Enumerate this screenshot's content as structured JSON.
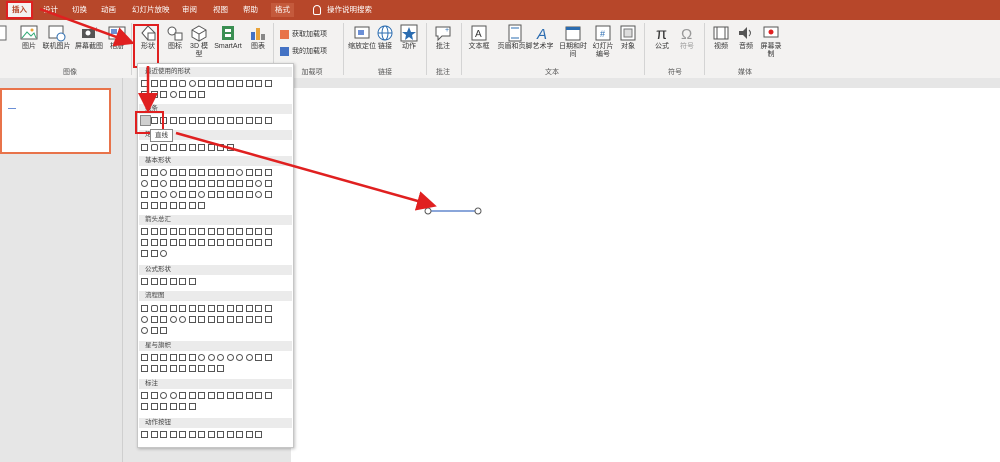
{
  "tabs": [
    "插入",
    "设计",
    "切换",
    "动画",
    "幻灯片放映",
    "审阅",
    "视图",
    "帮助",
    "格式"
  ],
  "tell_me": "操作说明搜索",
  "ribbon": {
    "images": {
      "picture": "图片",
      "online_picture": "联机图片",
      "screenshot": "屏幕截图",
      "album": "相册",
      "group": "图像"
    },
    "illustrations": {
      "shapes": "形状",
      "icons": "图标",
      "model3d": "3D 模型",
      "smartart": "SmartArt",
      "chart": "图表"
    },
    "addins": {
      "get": "获取加载项",
      "my": "我的加载项",
      "group": "加载项"
    },
    "links": {
      "zoom": "缩放定位",
      "link": "链接",
      "action": "动作",
      "group": "链接"
    },
    "comments": {
      "comment": "批注",
      "group": "批注"
    },
    "text": {
      "textbox": "文本框",
      "header_footer": "页眉和页脚",
      "wordart": "艺术字",
      "datetime": "日期和时间",
      "slide_number": "幻灯片编号",
      "object": "对象",
      "group": "文本"
    },
    "symbols": {
      "equation": "公式",
      "symbol": "符号",
      "group": "符号"
    },
    "media": {
      "video": "视频",
      "audio": "音频",
      "screen_recording": "屏幕录制",
      "group": "媒体"
    }
  },
  "gallery": {
    "sections": [
      "最近使用的形状",
      "线条",
      "矩形",
      "基本形状",
      "箭头总汇",
      "公式形状",
      "流程图",
      "星与旗帜",
      "标注",
      "动作按钮"
    ],
    "tooltip": "直线"
  },
  "colors": {
    "accent": "#b7472a",
    "highlight": "#e02020",
    "line": "#4472c4"
  }
}
